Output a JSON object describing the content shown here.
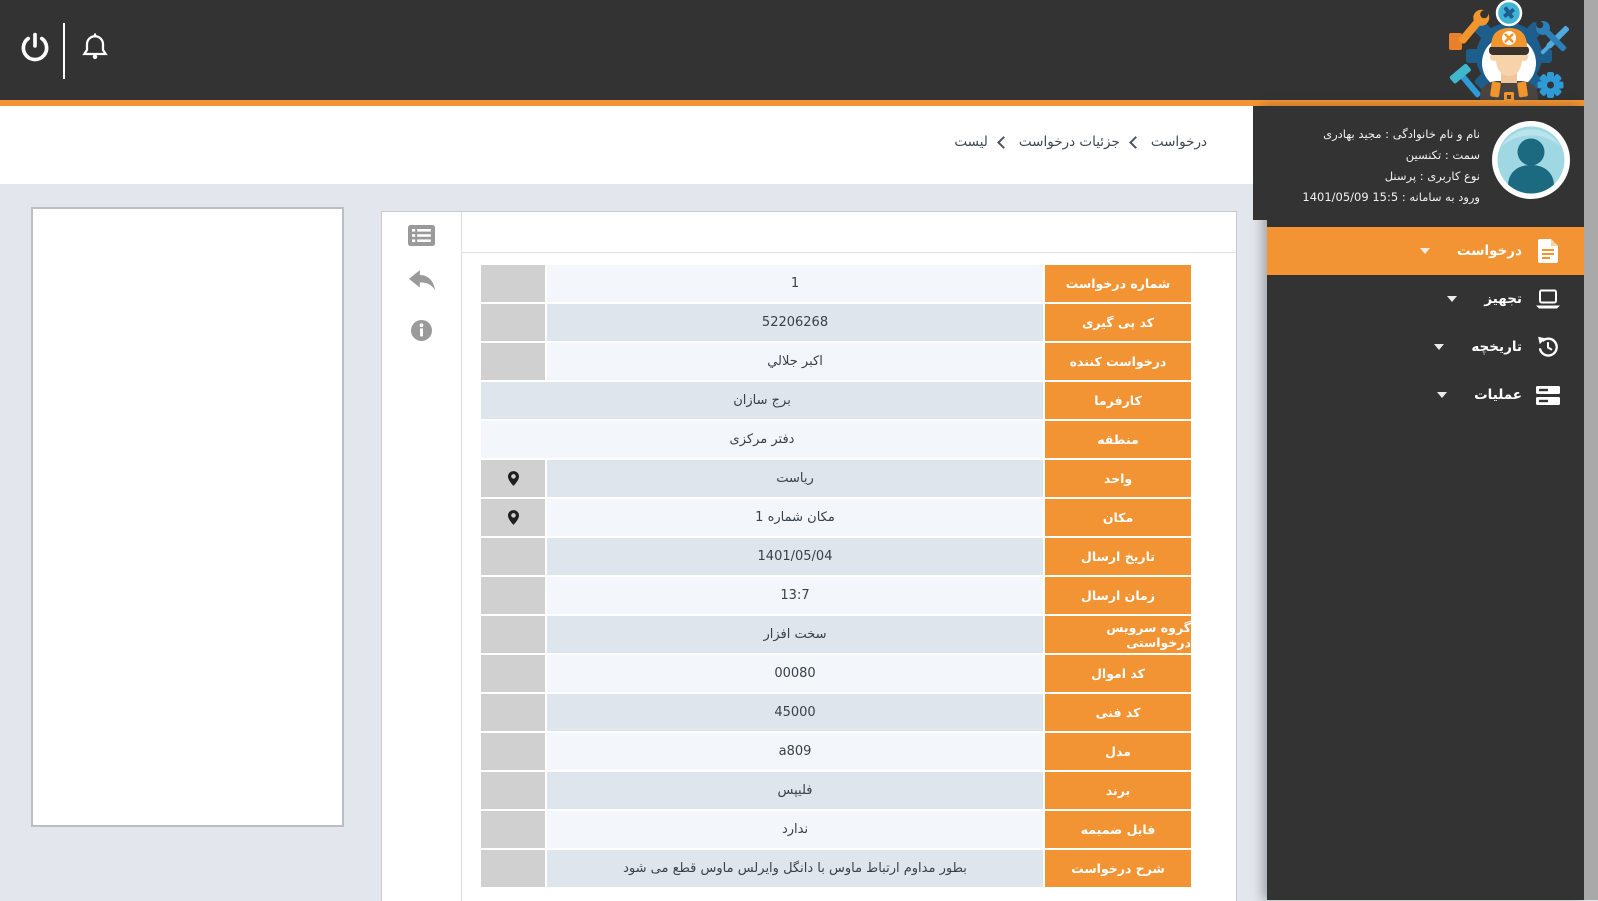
{
  "colors": {
    "accent_orange": "#F29434",
    "topbar_bg": "#333333",
    "row_light": "#F3F7FB",
    "row_dark": "#DFE5ED",
    "gray_cell": "#D0D0D0",
    "page_bg": "#E3E7ED",
    "scrollbar_gray": "#A9A9A9"
  },
  "topbar": {
    "icons": [
      {
        "name": "power-icon"
      },
      {
        "name": "bell-icon"
      }
    ]
  },
  "user_panel": {
    "full_name": "نام و نام خانوادگی : مجید بهادری",
    "position": "سمت : تکنسین",
    "user_type": "نوع کاربری : پرسنل",
    "login_time": "ورود به سامانه : 15:5 1401/05/09"
  },
  "sidebar": {
    "items": [
      {
        "label": "درخواست",
        "icon": "request-document-icon",
        "active": true
      },
      {
        "label": "تجهیز",
        "icon": "equipment-laptop-icon",
        "active": false
      },
      {
        "label": "تاریخچه",
        "icon": "history-icon",
        "active": false
      },
      {
        "label": "عملیات",
        "icon": "operations-icon",
        "active": false
      }
    ]
  },
  "breadcrumb": {
    "items": [
      "درخواست",
      "جزئیات درخواست",
      "لیست"
    ]
  },
  "toolbar": {
    "icons": [
      "list-details-icon",
      "back-icon",
      "info-icon"
    ]
  },
  "details": {
    "rows": [
      {
        "label": "شماره درخواست",
        "value": "1",
        "gray_cell": true,
        "pin": false
      },
      {
        "label": "کد پی گیری",
        "value": "52206268",
        "gray_cell": true,
        "pin": false
      },
      {
        "label": "درخواست کننده",
        "value": "اکبر جلالي",
        "gray_cell": true,
        "pin": false
      },
      {
        "label": "کارفرما",
        "value": "برج سازان",
        "gray_cell": false,
        "pin": false
      },
      {
        "label": "منطقه",
        "value": "دفتر مرکزی",
        "gray_cell": false,
        "pin": false
      },
      {
        "label": "واحد",
        "value": "ریاست",
        "gray_cell": true,
        "pin": true
      },
      {
        "label": "مکان",
        "value": "مکان شماره 1",
        "gray_cell": true,
        "pin": true
      },
      {
        "label": "تاریخ ارسال",
        "value": "1401/05/04",
        "gray_cell": true,
        "pin": false
      },
      {
        "label": "زمان ارسال",
        "value": "13:7",
        "gray_cell": true,
        "pin": false
      },
      {
        "label": "گروه سرویس درخواستی",
        "value": "سخت افزار",
        "gray_cell": true,
        "pin": false
      },
      {
        "label": "کد اموال",
        "value": "00080",
        "gray_cell": true,
        "pin": false
      },
      {
        "label": "کد فنی",
        "value": "45000",
        "gray_cell": true,
        "pin": false
      },
      {
        "label": "مدل",
        "value": "a809",
        "gray_cell": true,
        "pin": false
      },
      {
        "label": "برند",
        "value": "فلیپس",
        "gray_cell": true,
        "pin": false
      },
      {
        "label": "فایل ضمیمه",
        "value": "ندارد",
        "gray_cell": true,
        "pin": false
      },
      {
        "label": "شرح درخواست",
        "value": "بطور مداوم ارتباط ماوس با دانگل وایرلس ماوس قطع می شود",
        "gray_cell": true,
        "pin": false
      }
    ]
  }
}
